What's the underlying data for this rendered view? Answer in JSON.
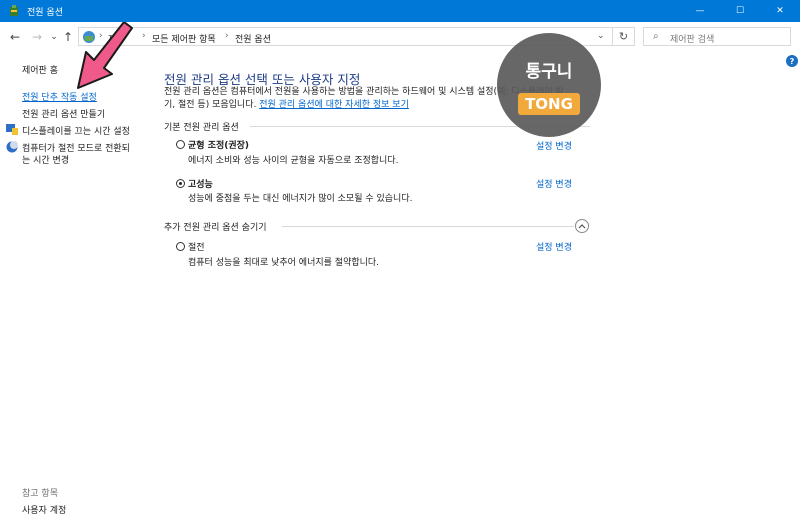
{
  "window": {
    "title": "전원 옵션",
    "minimize_glyph": "—",
    "maximize_glyph": "☐",
    "close_glyph": "✕"
  },
  "nav": {
    "back_icon": "arrow-left-icon",
    "forward_icon": "arrow-right-icon",
    "recent_icon": "chevron-down-icon",
    "up_icon": "arrow-up-icon",
    "address": {
      "crumbs": [
        "제",
        "모든 제어판 항목",
        "전원 옵션"
      ]
    },
    "refresh_icon": "refresh-icon",
    "search": {
      "placeholder": "제어판 검색"
    }
  },
  "sidebar": {
    "items": [
      {
        "label": "제어판 홈"
      },
      {
        "label": "전원 단추 작동 설정"
      },
      {
        "label": "전원 관리 옵션 만들기"
      },
      {
        "label": "디스플레이를 끄는 시간 설정"
      },
      {
        "label": "컴퓨터가 절전 모드로 전환되",
        "label2": "는 시간 변경"
      }
    ],
    "see_also": {
      "title": "참고 항목",
      "items": [
        {
          "label": "사용자 계정"
        }
      ]
    }
  },
  "main": {
    "heading": "전원 관리 옵션 선택 또는 사용자 지정",
    "description_line1": "전원 관리 옵션은 컴퓨터에서 전원을 사용하는 방법을 관리하는 하드웨어 및 시스템 설정(예: 디스플레이 밝",
    "description_line2_prefix": "기, 절전 등) 모음입니다. ",
    "description_link": "전원 관리 옵션에 대한 자세한 정보 보기",
    "basic_group_label": "기본 전원 관리 옵션",
    "extra_group_label": "추가 전원 관리 옵션 숨기기",
    "plans": [
      {
        "name": "균형 조정(권장)",
        "desc": "에너지 소비와 성능 사이의 균형을 자동으로 조정합니다.",
        "change": "설정 변경",
        "selected": false
      },
      {
        "name": "고성능",
        "desc": "성능에 중점을 두는 대신 에너지가 많이 소모될 수 있습니다.",
        "change": "설정 변경",
        "selected": true
      },
      {
        "name": "절전",
        "desc": "컴퓨터 성능을 최대로 낮추어 에너지를 절약합니다.",
        "change": "설정 변경",
        "selected": false
      }
    ]
  },
  "overlay": {
    "logo_line1": "통구니",
    "logo_line2": "TONG"
  },
  "help": {
    "glyph": "?"
  },
  "colors": {
    "titlebar": "#0078d7",
    "link": "#0066cc",
    "heading": "#1f3c88",
    "arrow": "#f05a8a",
    "logo_badge": "#f2a93b"
  }
}
